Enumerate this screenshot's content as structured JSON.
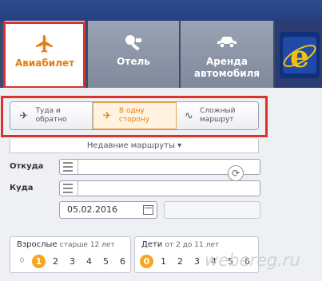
{
  "tabs": [
    {
      "label": "Авиабилет",
      "icon": "airplane-icon",
      "active": true
    },
    {
      "label": "Отель",
      "icon": "hotel-key-icon"
    },
    {
      "label": "Аренда автомобиля",
      "icon": "car-icon"
    }
  ],
  "trip_types": [
    {
      "label": "Туда и обратно",
      "icon": "round-trip-icon"
    },
    {
      "label": "В одну сторону",
      "icon": "one-way-icon",
      "active": true
    },
    {
      "label": "Сложный маршрут",
      "icon": "multi-route-icon"
    }
  ],
  "recent_routes": {
    "label": "Недавние маршруты ▾"
  },
  "from_field": {
    "label": "Откуда",
    "value": ""
  },
  "to_field": {
    "label": "Куда",
    "value": ""
  },
  "depart_date": {
    "value": "05.02.2016"
  },
  "return_date": {
    "value": ""
  },
  "adults": {
    "label": "Взрослые",
    "sub": "старше 12 лет",
    "options": [
      "0",
      "1",
      "2",
      "3",
      "4",
      "5",
      "6"
    ],
    "selected": "1"
  },
  "children": {
    "label": "Дети",
    "sub": "от 2 до 11 лет",
    "options": [
      "0",
      "1",
      "2",
      "3",
      "4",
      "5",
      "6"
    ],
    "selected": "0"
  },
  "watermark": "webereg.ru",
  "colors": {
    "accent": "#e47d14",
    "highlight": "#d9332c",
    "brand": "#2f4c92"
  }
}
